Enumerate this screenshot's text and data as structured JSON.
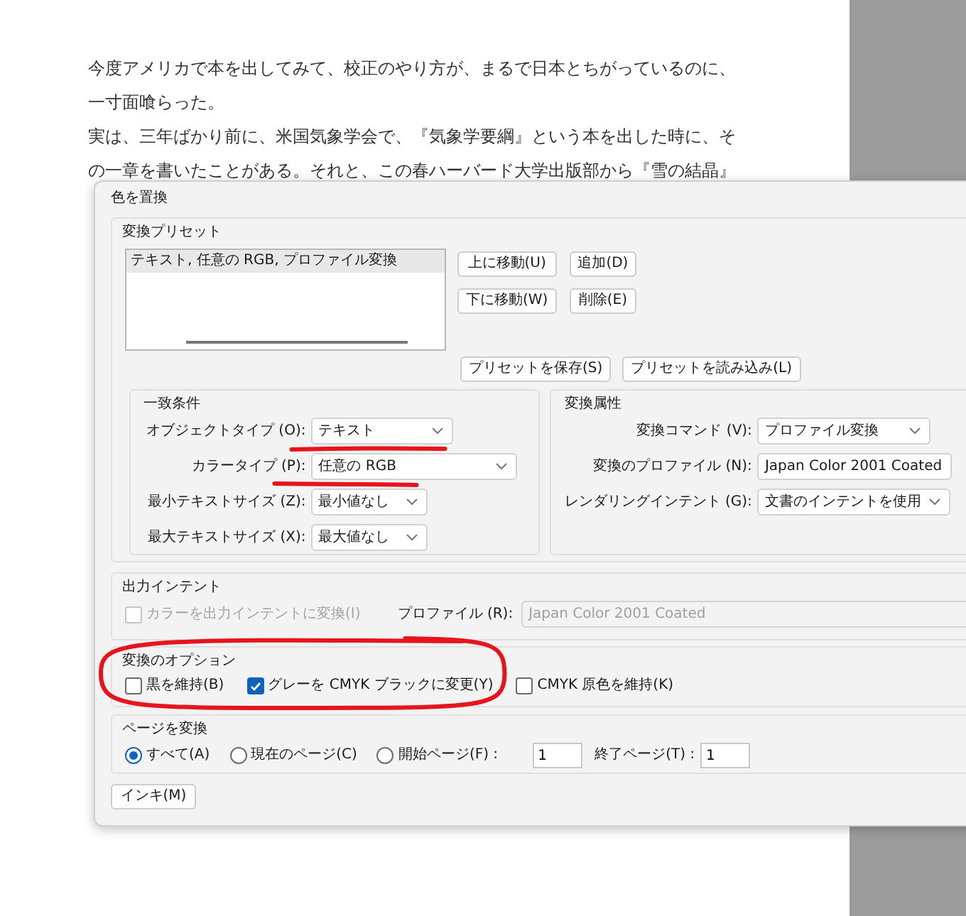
{
  "document": {
    "lines": [
      "今度アメリカで本を出してみて、校正のやり方が、まるで日本とちがっているのに、",
      "一寸面喰らった。",
      "実は、三年ばかり前に、米国気象学会で、『気象学要綱』という本を出した時に、そ",
      "の一章を書いたことがある。それと、この春ハーバード大学出版部から『雪の結晶』"
    ]
  },
  "dialog": {
    "title": "色を置換",
    "presets": {
      "label": "変換プリセット",
      "items": [
        {
          "text": "テキスト, 任意の RGB, プロファイル変換",
          "selected": true
        }
      ],
      "buttons": [
        "上に移動(U)",
        "追加(D)",
        "下に移動(W)",
        "削除(E)"
      ],
      "file_buttons": [
        "プリセットを保存(S)",
        "プリセットを読み込み(L)"
      ]
    },
    "match": {
      "label": "一致条件",
      "fields": [
        {
          "label": "オブジェクトタイプ (O):",
          "value": "テキスト"
        },
        {
          "label": "カラータイプ (P):",
          "value": "任意の RGB"
        },
        {
          "label": "最小テキストサイズ (Z):",
          "value": "最小値なし"
        },
        {
          "label": "最大テキストサイズ (X):",
          "value": "最大値なし"
        }
      ]
    },
    "attributes": {
      "label": "変換属性",
      "fields": [
        {
          "label": "変換コマンド (V):",
          "value": "プロファイル変換",
          "kind": "dropdown"
        },
        {
          "label": "変換のプロファイル (N):",
          "value": "Japan Color 2001 Coated",
          "kind": "text"
        },
        {
          "label": "レンダリングインテント (G):",
          "value": "文書のインテントを使用",
          "kind": "dropdown"
        }
      ]
    },
    "output_intent": {
      "label": "出力インテント",
      "checkbox": {
        "label": "カラーを出力インテントに変換(I)",
        "checked": false,
        "disabled": true
      },
      "profile": {
        "label": "プロファイル (R):",
        "value": "Japan Color 2001 Coated",
        "disabled": true
      }
    },
    "options": {
      "label": "変換のオプション",
      "checkboxes": [
        {
          "label": "黒を維持(B)",
          "checked": false
        },
        {
          "label": "グレーを CMYK ブラックに変更(Y)",
          "checked": true
        },
        {
          "label": "CMYK 原色を維持(K)",
          "checked": false
        }
      ]
    },
    "pages": {
      "label": "ページを変換",
      "radios": [
        {
          "label": "すべて(A)",
          "selected": true
        },
        {
          "label": "現在のページ(C)",
          "selected": false
        },
        {
          "label": "開始ページ(F) :",
          "selected": false
        }
      ],
      "from": "1",
      "to_label": "終了ページ(T) :",
      "to": "1"
    },
    "ink_button": "インキ(M)"
  }
}
